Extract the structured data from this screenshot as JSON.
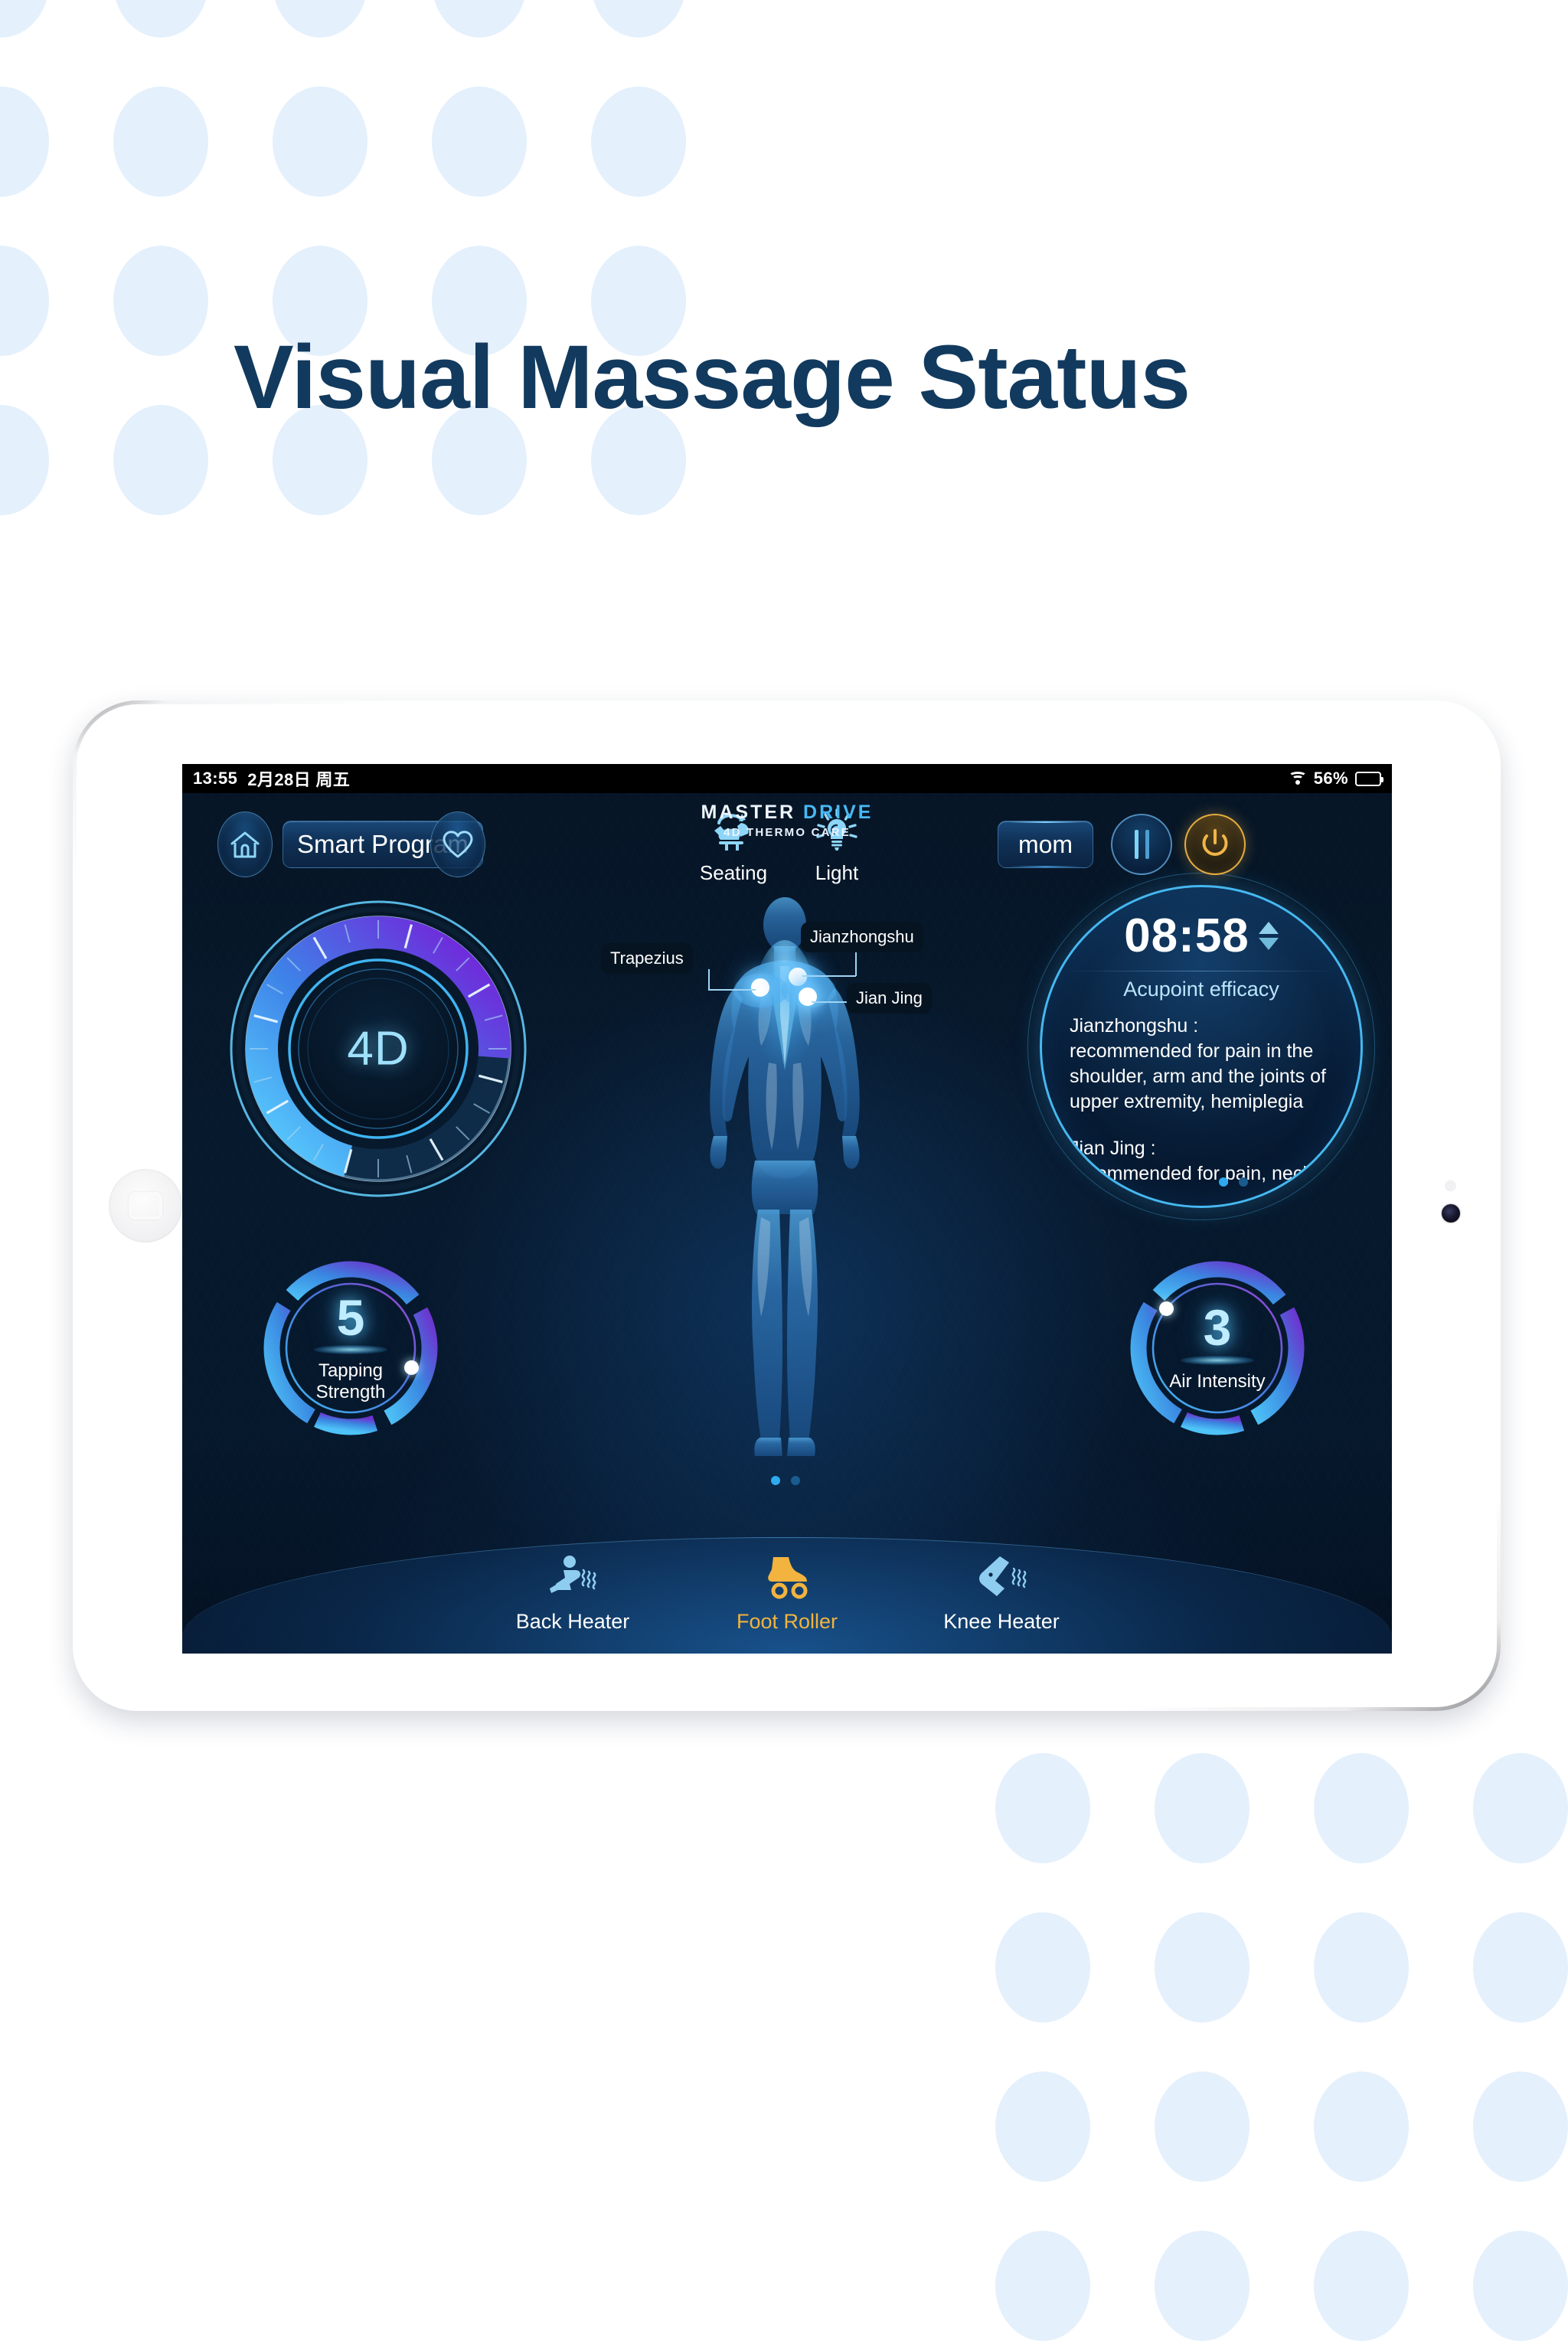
{
  "page": {
    "title": "Visual Massage Status",
    "title_color": "#123a5e",
    "bg_color": "#ffffff",
    "dot_color": "#e4f0fc"
  },
  "status_bar": {
    "time": "13:55",
    "date": "2月28日 周五",
    "wifi_icon": "wifi-icon",
    "battery_percent": "56%",
    "battery_level": 56
  },
  "brand": {
    "word1": "MASTER",
    "word2": "DRIVE",
    "tagline": "4D THERMO CARE",
    "word1_color": "#eef6ff",
    "word2_color": "#49b8f5"
  },
  "toolbar": {
    "home_icon": "home-icon",
    "smart_program_label": "Smart Program",
    "favorite_icon": "heart-icon",
    "profile_label": "mom",
    "pause_icon": "pause-icon",
    "power_icon": "power-icon",
    "power_color": "#f0b646",
    "items": [
      {
        "label": "Seating",
        "icon": "recline-chair-icon"
      },
      {
        "label": "Light",
        "icon": "lightbulb-icon"
      }
    ]
  },
  "main_gauge": {
    "center_label": "4D",
    "arc_start_color": "#5ad3ff",
    "arc_end_color": "#7a18d8",
    "value_fraction": 0.72,
    "tick_count": 24
  },
  "body_figure": {
    "view": "posterior",
    "acupoints": [
      {
        "name": "Trapezius",
        "side": "left"
      },
      {
        "name": "Jianzhongshu",
        "side": "right-upper"
      },
      {
        "name": "Jian Jing",
        "side": "right-lower"
      }
    ],
    "page_dots": {
      "count": 2,
      "active_index": 0
    }
  },
  "info_panel": {
    "timer": "08:58",
    "stepper_up_icon": "triangle-up-icon",
    "stepper_down_icon": "triangle-down-icon",
    "subtitle": "Acupoint efficacy",
    "entries": [
      {
        "name": "Jianzhongshu :",
        "description": "recommended for pain in the shoulder, arm and the joints of upper extremity, hemiplegia"
      },
      {
        "name": "Jian Jing :",
        "description": "recommended for pain, neck"
      }
    ],
    "page_dots": {
      "count": 2,
      "active_index": 0
    },
    "accent_color": "#46b8f0"
  },
  "dials": [
    {
      "value": "5",
      "label": "Tapping\nStrength",
      "label_line1": "Tapping",
      "label_line2": "Strength",
      "max": 10,
      "knob_angle_deg": 108
    },
    {
      "value": "3",
      "label": "Air Intensity",
      "label_line1": "Air Intensity",
      "label_line2": "",
      "max": 10,
      "knob_angle_deg": -52
    }
  ],
  "bottom_tabs": [
    {
      "label": "Back Heater",
      "icon": "seated-person-heat-icon",
      "active": false,
      "color": "#8fcdf0"
    },
    {
      "label": "Foot Roller",
      "icon": "roller-skate-icon",
      "active": true,
      "color": "#f2b33f"
    },
    {
      "label": "Knee Heater",
      "icon": "knee-heat-icon",
      "active": false,
      "color": "#8fcdf0"
    }
  ],
  "device": {
    "home_button_icon": "home-button-icon",
    "camera_icon": "front-camera-icon",
    "sensor_icon": "ambient-sensor-icon"
  }
}
